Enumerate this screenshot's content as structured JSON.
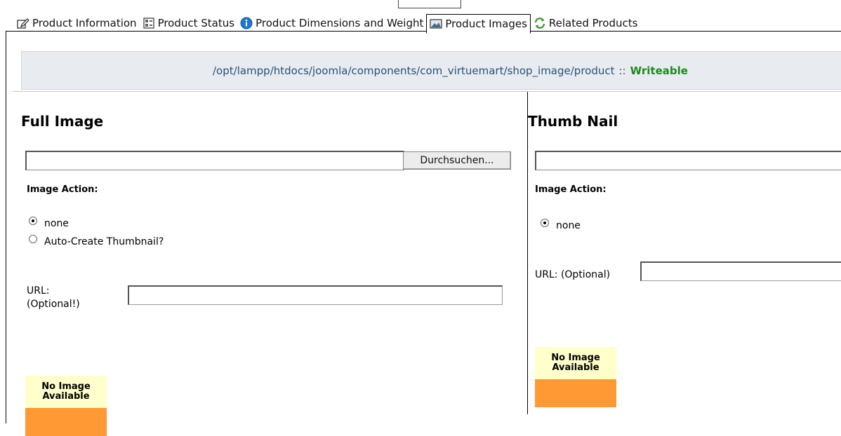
{
  "tabs": [
    {
      "label": "Product Information",
      "icon": "edit-icon"
    },
    {
      "label": "Product Status",
      "icon": "status-icon"
    },
    {
      "label": "Product Dimensions and Weight",
      "icon": "info-icon"
    },
    {
      "label": "Product Images",
      "icon": "image-icon",
      "active": true
    },
    {
      "label": "Related Products",
      "icon": "refresh-icon"
    }
  ],
  "path_bar": {
    "path": "/opt/lampp/htdocs/joomla/components/com_virtuemart/shop_image/product",
    "separator": "::",
    "status": "Writeable"
  },
  "full_image": {
    "title": "Full Image",
    "browse_label": "Durchsuchen...",
    "image_action_label": "Image Action:",
    "options": [
      {
        "label": "none",
        "checked": true
      },
      {
        "label": "Auto-Create Thumbnail?",
        "checked": false
      }
    ],
    "url_label_line1": "URL:",
    "url_label_line2": "(Optional!)",
    "url_value": "",
    "no_image_line1": "No Image",
    "no_image_line2": "Available"
  },
  "thumb_nail": {
    "title": "Thumb Nail",
    "image_action_label": "Image Action:",
    "options": [
      {
        "label": "none",
        "checked": true
      }
    ],
    "url_label": "URL: (Optional)",
    "url_value": "",
    "no_image_line1": "No Image",
    "no_image_line2": "Available"
  },
  "colors": {
    "path_text": "#28507a",
    "writeable": "#1b8a1b",
    "path_bg": "#e8ecf0",
    "no_image_top": "#ffffcc",
    "no_image_bottom": "#ff9933"
  }
}
